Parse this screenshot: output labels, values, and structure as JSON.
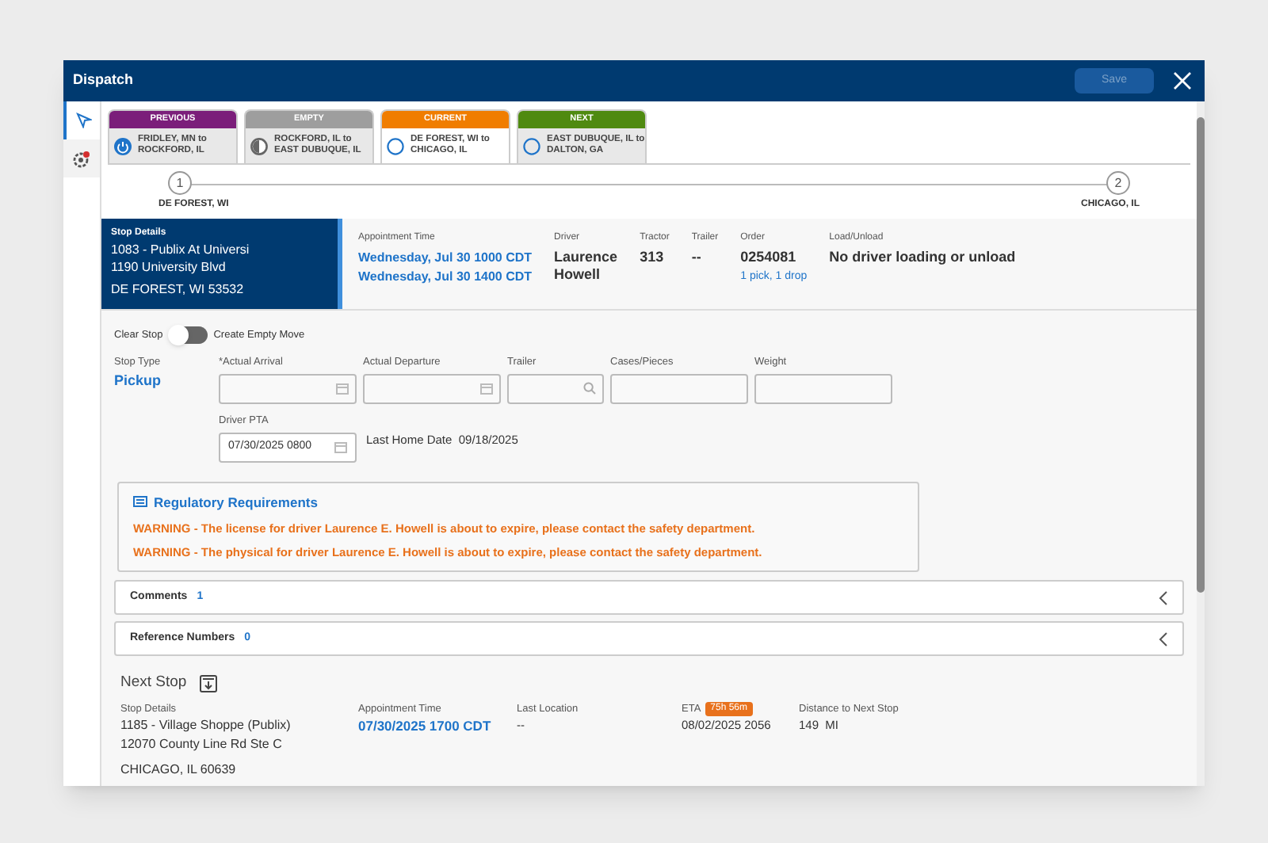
{
  "window": {
    "title": "Dispatch",
    "save_button": {
      "label": "Save",
      "disabled": true
    }
  },
  "rail": [
    {
      "kind": "send",
      "selected": true
    },
    {
      "kind": "alert",
      "selected": false
    }
  ],
  "legs": [
    {
      "header": "PREVIOUS",
      "color": "#7b1e7a",
      "route": [
        "FRIDLEY, MN to",
        "ROCKFORD, IL"
      ],
      "kind": "done",
      "selected": false
    },
    {
      "header": "EMPTY",
      "color": "#9e9e9e",
      "route": [
        "ROCKFORD, IL to",
        "EAST DUBUQUE, IL"
      ],
      "kind": "partial",
      "selected": false
    },
    {
      "header": "CURRENT",
      "color": "#f07d00",
      "route": [
        "DE FOREST, WI to",
        "CHICAGO, IL"
      ],
      "kind": "pending",
      "selected": true
    },
    {
      "header": "NEXT",
      "color": "#4f8a10",
      "route": [
        "EAST DUBUQUE, IL to",
        "DALTON, GA"
      ],
      "kind": "pending",
      "selected": false
    }
  ],
  "stepper": [
    {
      "number": "1",
      "label": "DE FOREST, WI"
    },
    {
      "number": "2",
      "label": "CHICAGO, IL"
    }
  ],
  "stop_details": {
    "label": "Stop Details",
    "lines": [
      "1083 - Publix At Universi",
      "1190 University Blvd",
      "DE FOREST, WI 53532"
    ]
  },
  "summary": [
    {
      "label": "Appointment Time",
      "kind": "link",
      "values": [
        "Wednesday, Jul 30 1000 CDT",
        "Wednesday, Jul 30 1400 CDT"
      ]
    },
    {
      "label": "Driver",
      "kind": "bold",
      "values": [
        "Laurence",
        "Howell"
      ]
    },
    {
      "label": "Tractor",
      "kind": "bold",
      "values": [
        "313"
      ]
    },
    {
      "label": "Trailer",
      "kind": "bold",
      "values": [
        "--"
      ]
    },
    {
      "label": "Order",
      "kind": "bold",
      "values": [
        "0254081"
      ],
      "link": "1 pick, 1 drop"
    },
    {
      "label": "Load/Unload",
      "kind": "bold",
      "values": [
        "No driver loading or unload"
      ]
    }
  ],
  "toggle": {
    "left_label": "Clear Stop",
    "right_label": "Create Empty Move",
    "on": false
  },
  "stop_type": {
    "label": "Stop Type",
    "value": "Pickup"
  },
  "fields": [
    {
      "label": "*Actual Arrival",
      "kind": "date"
    },
    {
      "label": "Actual Departure",
      "kind": "date"
    },
    {
      "label": "Trailer",
      "kind": "search"
    },
    {
      "label": "Cases/Pieces",
      "kind": "text"
    },
    {
      "label": "Weight",
      "kind": "text"
    }
  ],
  "driver_pta": {
    "label": "Driver PTA",
    "value": "07/30/2025 0800"
  },
  "last_home": {
    "label": "Last Home Date",
    "value": "09/18/2025"
  },
  "regulatory": {
    "title": "Regulatory Requirements",
    "warnings": [
      "WARNING - The license for driver Laurence E. Howell is about to expire, please contact the safety department.",
      "WARNING - The physical for driver Laurence E. Howell is about to expire, please contact the safety department."
    ]
  },
  "panels": [
    {
      "title": "Comments",
      "count": "1",
      "expanded": false
    },
    {
      "title": "Reference Numbers",
      "count": "0",
      "expanded": false
    }
  ],
  "next_stop": {
    "title": "Next Stop",
    "stop_label": "Stop Details",
    "stop_lines": [
      "1185 - Village Shoppe (Publix)",
      "12070 County Line Rd Ste C",
      "CHICAGO, IL 60639"
    ],
    "appt_label": "Appointment Time",
    "appt": "07/30/2025 1700 CDT",
    "loc_label": "Last Location",
    "loc": "--",
    "eta_label": "ETA",
    "eta_badge": "75h 56m",
    "eta": "08/02/2025 2056",
    "dist_label": "Distance to Next Stop",
    "dist": "149  MI"
  }
}
